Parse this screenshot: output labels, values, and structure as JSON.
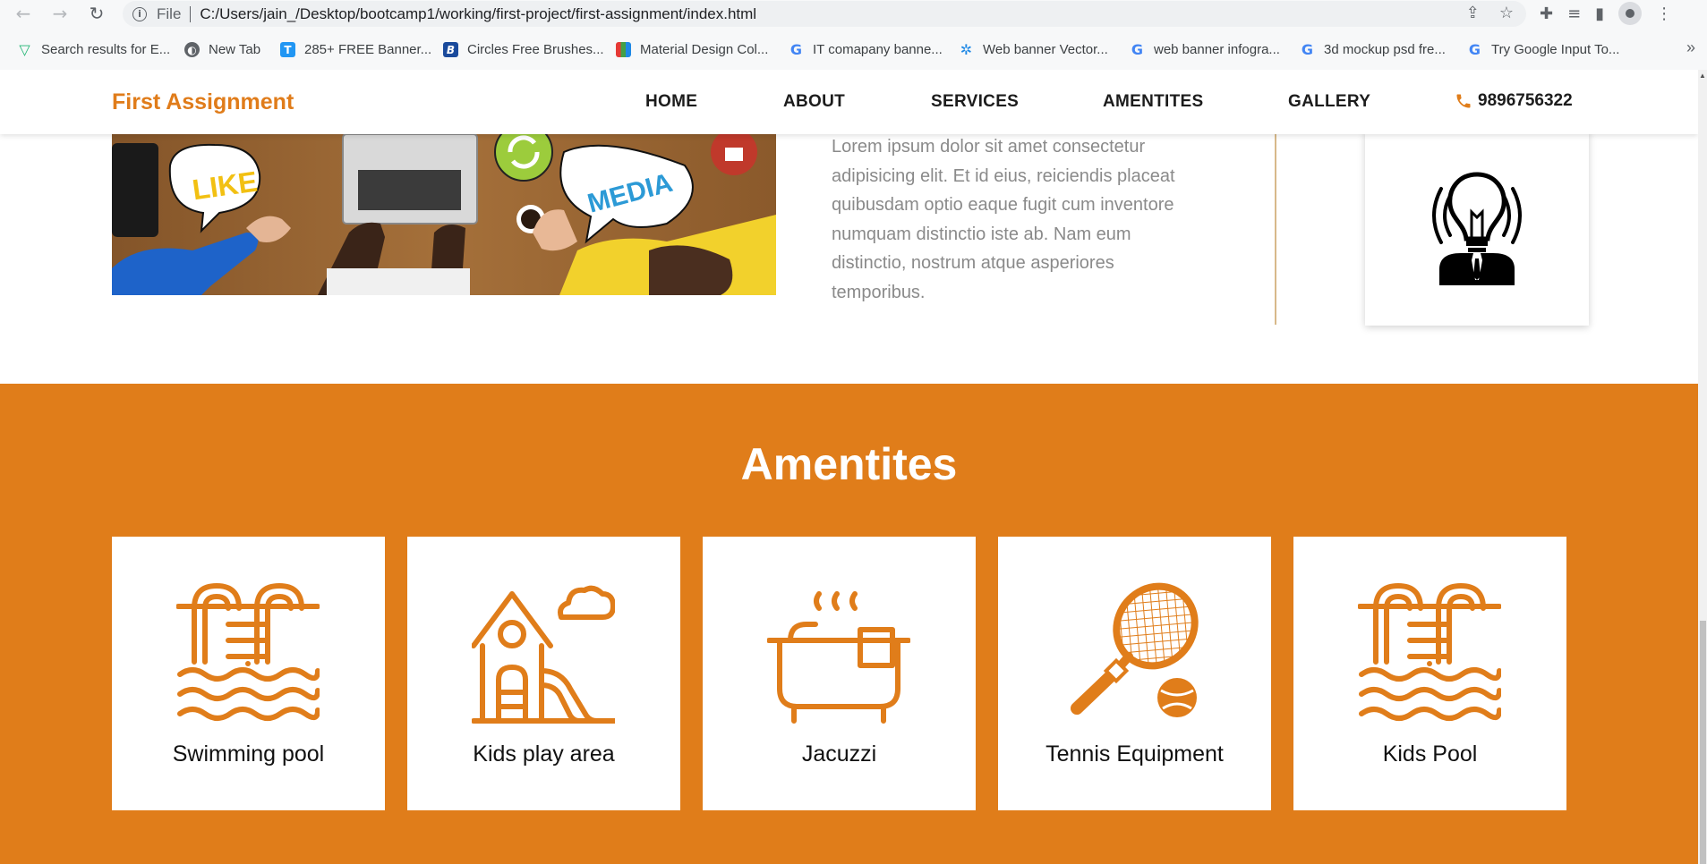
{
  "browser": {
    "file_label": "File",
    "url": "C:/Users/jain_/Desktop/bootcamp1/working/first-project/first-assignment/index.html",
    "bookmarks": [
      {
        "label": "Search results for E...",
        "icon": "vector-logo-icon"
      },
      {
        "label": "New Tab",
        "icon": "globe-icon"
      },
      {
        "label": "285+ FREE Banner...",
        "icon": "t-logo-icon"
      },
      {
        "label": "Circles Free Brushes...",
        "icon": "b-logo-icon"
      },
      {
        "label": "Material Design Col...",
        "icon": "palette-icon"
      },
      {
        "label": "IT comapany banne...",
        "icon": "google-icon"
      },
      {
        "label": "Web banner Vector...",
        "icon": "gear-icon"
      },
      {
        "label": "web banner infogra...",
        "icon": "google-icon"
      },
      {
        "label": "3d mockup psd fre...",
        "icon": "google-icon"
      },
      {
        "label": "Try Google Input To...",
        "icon": "google-icon"
      }
    ],
    "more_label": "»"
  },
  "navbar": {
    "brand": "First Assignment",
    "links": [
      "HOME",
      "ABOUT",
      "SERVICES",
      "AMENTITES",
      "GALLERY"
    ],
    "phone": "9896756322"
  },
  "about": {
    "image_labels": {
      "like": "LIKE",
      "media": "MEDIA"
    },
    "text": "Lorem ipsum dolor sit amet consectetur adipisicing elit. Et id eius, reiciendis placeat quibusdam optio eaque fugit cum inventore numquam distinctio iste ab. Nam eum distinctio, nostrum atque asperiores temporibus."
  },
  "amenities": {
    "title": "Amentites",
    "items": [
      {
        "label": "Swimming pool",
        "icon": "pool-ladder-icon"
      },
      {
        "label": "Kids play area",
        "icon": "playhouse-slide-icon"
      },
      {
        "label": "Jacuzzi",
        "icon": "bathtub-icon"
      },
      {
        "label": "Tennis Equipment",
        "icon": "tennis-racket-icon"
      },
      {
        "label": "Kids Pool",
        "icon": "pool-ladder-icon"
      }
    ]
  },
  "colors": {
    "accent": "#e07d1a",
    "text_muted": "#8a8a8a",
    "nav_text": "#1c1c1c"
  }
}
